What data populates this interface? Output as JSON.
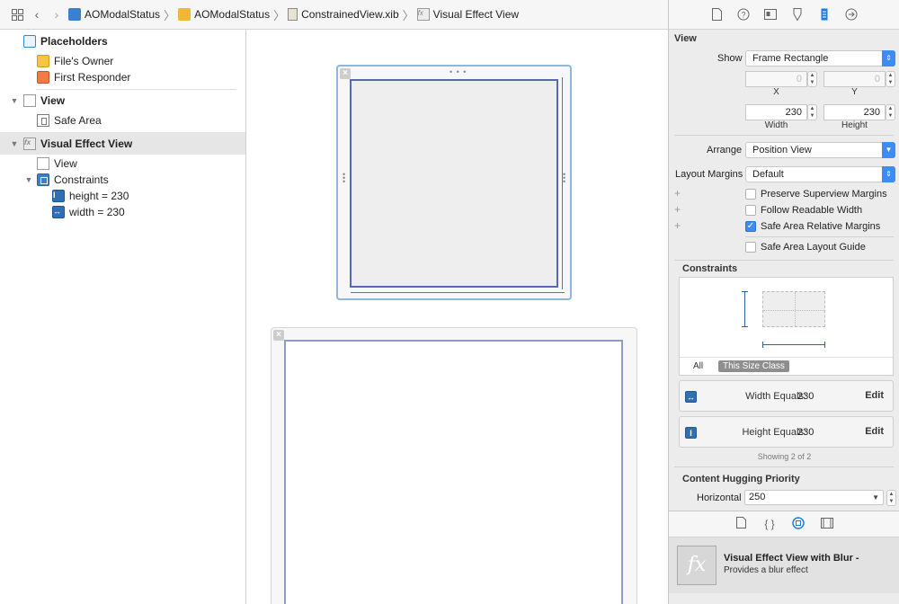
{
  "jumpbar": {
    "breadcrumbs": [
      {
        "label": "AOModalStatus",
        "icon": "project-icon"
      },
      {
        "label": "AOModalStatus",
        "icon": "folder-icon"
      },
      {
        "label": "ConstrainedView.xib",
        "icon": "xib-file-icon"
      },
      {
        "label": "Visual Effect View",
        "icon": "visual-effect-icon"
      }
    ]
  },
  "outline": {
    "placeholders": "Placeholders",
    "files_owner": "File's Owner",
    "first_responder": "First Responder",
    "view": "View",
    "safe_area": "Safe Area",
    "visual_effect_view": "Visual Effect View",
    "vev_view": "View",
    "constraints": "Constraints",
    "height_constraint": "height = 230",
    "width_constraint": "width = 230"
  },
  "inspector": {
    "section_title": "View",
    "show_label": "Show",
    "show_value": "Frame Rectangle",
    "x_value": "0",
    "y_value": "0",
    "x_caption": "X",
    "y_caption": "Y",
    "width_value": "230",
    "height_value": "230",
    "width_caption": "Width",
    "height_caption": "Height",
    "arrange_label": "Arrange",
    "arrange_value": "Position View",
    "layout_margins_label": "Layout Margins",
    "layout_margins_value": "Default",
    "checks": [
      {
        "label": "Preserve Superview Margins",
        "checked": false
      },
      {
        "label": "Follow Readable Width",
        "checked": false
      },
      {
        "label": "Safe Area Relative Margins",
        "checked": true
      },
      {
        "label": "Safe Area Layout Guide",
        "checked": false
      }
    ],
    "constraints_title": "Constraints",
    "tab_all": "All",
    "tab_size_class": "This Size Class",
    "constraint_rows": [
      {
        "name": "Width Equals:",
        "value": "230",
        "edit": "Edit"
      },
      {
        "name": "Height Equals:",
        "value": "230",
        "edit": "Edit"
      }
    ],
    "showing": "Showing 2 of 2",
    "hugging_title": "Content Hugging Priority",
    "horizontal_label": "Horizontal",
    "horizontal_value": "250"
  },
  "library": {
    "item_title": "Visual Effect View with Blur",
    "item_title_suffix": " -",
    "item_desc": "Provides a blur effect",
    "item_icon": "fx-icon"
  },
  "colors": {
    "accent": "#3b8cf4",
    "selection": "#e6e6e6",
    "constraint_blue": "#2f6fb4"
  }
}
